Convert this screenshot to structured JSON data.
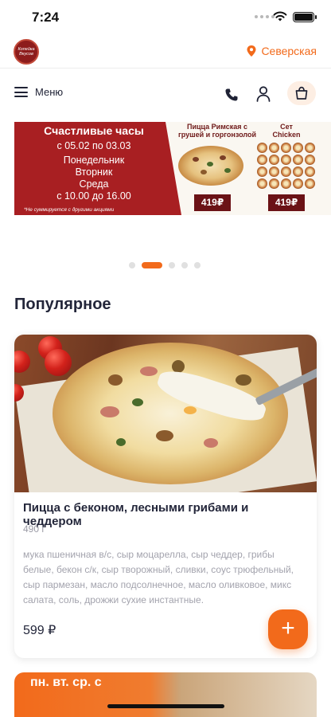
{
  "status_bar": {
    "time": "7:24"
  },
  "header": {
    "logo_text_1": "Копейка",
    "logo_text_2": "Вкусов",
    "location": "Северская"
  },
  "nav": {
    "menu_label": "Меню"
  },
  "banner": {
    "title": "Счастливые часы",
    "dates": "с 05.02 по 03.03",
    "day_1": "Понедельник",
    "day_2": "Вторник",
    "day_3": "Среда",
    "hours": "с 10.00 до 16.00",
    "note": "*Не суммируется с другими акциями",
    "pizza_title": "Пицца Римская с грушей и горгонзолой",
    "pizza_price": "419₽",
    "set_title": "Сет Chicken",
    "set_price": "419₽"
  },
  "pager": {
    "total": 5,
    "active_index": 1
  },
  "section": {
    "title": "Популярное"
  },
  "product": {
    "name": "Пицца с беконом, лесными грибами и чеддером",
    "weight": "490 г",
    "description": "мука пшеничная в/с, сыр моцарелла, сыр чеддер, грибы белые, бекон с/к, сыр творожный, сливки, соус трюфельный, сыр пармезан, масло подсолнечное, масло оливковое, микс салата, соль, дрожжи сухие инстантные.",
    "price": "599 ₽",
    "add_label": "+"
  },
  "next_card": {
    "label": "пн. вт. ср. с"
  },
  "colors": {
    "accent": "#f26a1b",
    "banner_red": "#a81f22",
    "text_dark": "#23263a",
    "text_muted": "#a3a3ad"
  }
}
